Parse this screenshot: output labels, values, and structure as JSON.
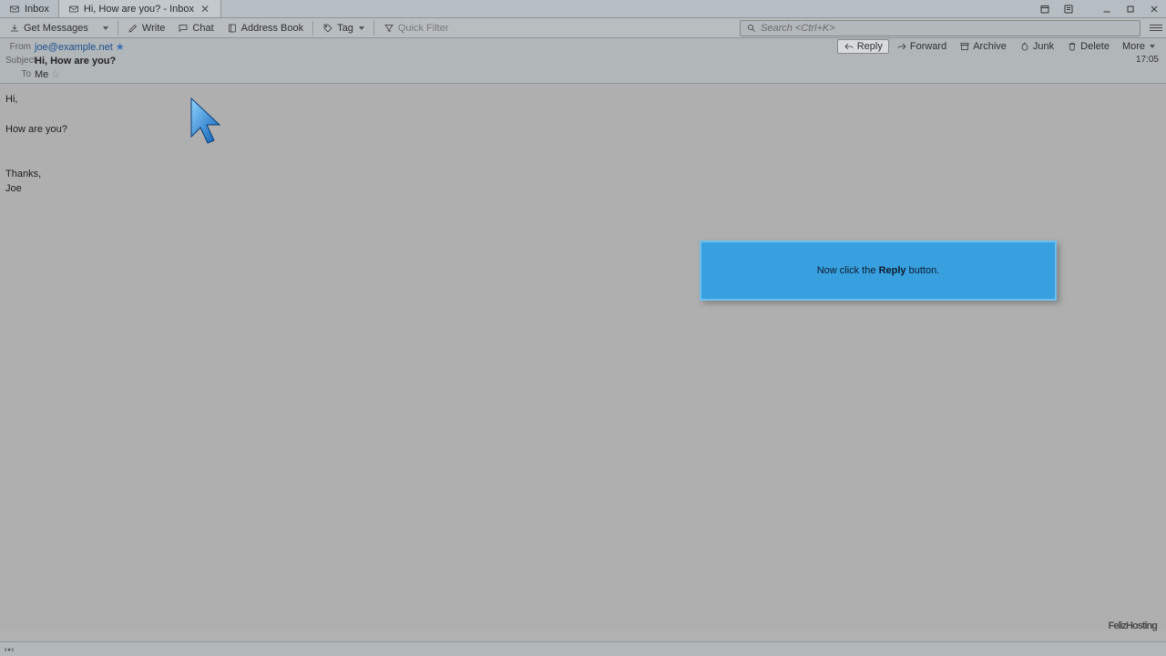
{
  "tabs": {
    "inactive": "Inbox",
    "active": "Hi, How are you? - Inbox"
  },
  "toolbar": {
    "get_messages": "Get Messages",
    "write": "Write",
    "chat": "Chat",
    "address_book": "Address Book",
    "tag": "Tag",
    "quick_filter": "Quick Filter",
    "search_placeholder": "Search <Ctrl+K>"
  },
  "header": {
    "from_label": "From",
    "from_value": "joe@example.net",
    "subject_label": "Subject",
    "subject_value": "Hi, How are you?",
    "to_label": "To",
    "to_value": "Me",
    "time": "17:05"
  },
  "actions": {
    "reply": "Reply",
    "forward": "Forward",
    "archive": "Archive",
    "junk": "Junk",
    "delete": "Delete",
    "more": "More"
  },
  "body": {
    "line1": "Hi,",
    "line2": "",
    "line3": "How are you?",
    "line4": "",
    "line5": "",
    "line6": "Thanks,",
    "line7": "Joe"
  },
  "callout": {
    "pre": "Now click the ",
    "bold": "Reply",
    "post": " button."
  },
  "watermark": "FelizHosting"
}
